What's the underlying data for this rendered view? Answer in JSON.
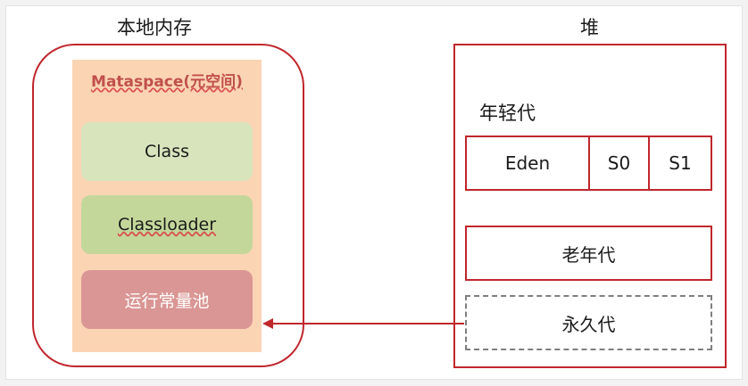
{
  "local_memory": {
    "title": "本地内存",
    "metaspace_title": "Mataspace(元空间)",
    "items": [
      {
        "label": "Class",
        "color": "#d8e4bc"
      },
      {
        "label": "Classloader",
        "color": "#c4d79b"
      },
      {
        "label": "运行常量池",
        "color": "#da9694"
      }
    ]
  },
  "heap": {
    "title": "堆",
    "young_label": "年轻代",
    "young_cells": [
      "Eden",
      "S0",
      "S1"
    ],
    "old_gen": "老年代",
    "perm_gen": "永久代"
  },
  "colors": {
    "border_red": "#c0272d",
    "metaspace_bg": "#fbd4b4",
    "metaspace_title": "#c0504d",
    "dashed_gray": "#7f7f7f"
  }
}
